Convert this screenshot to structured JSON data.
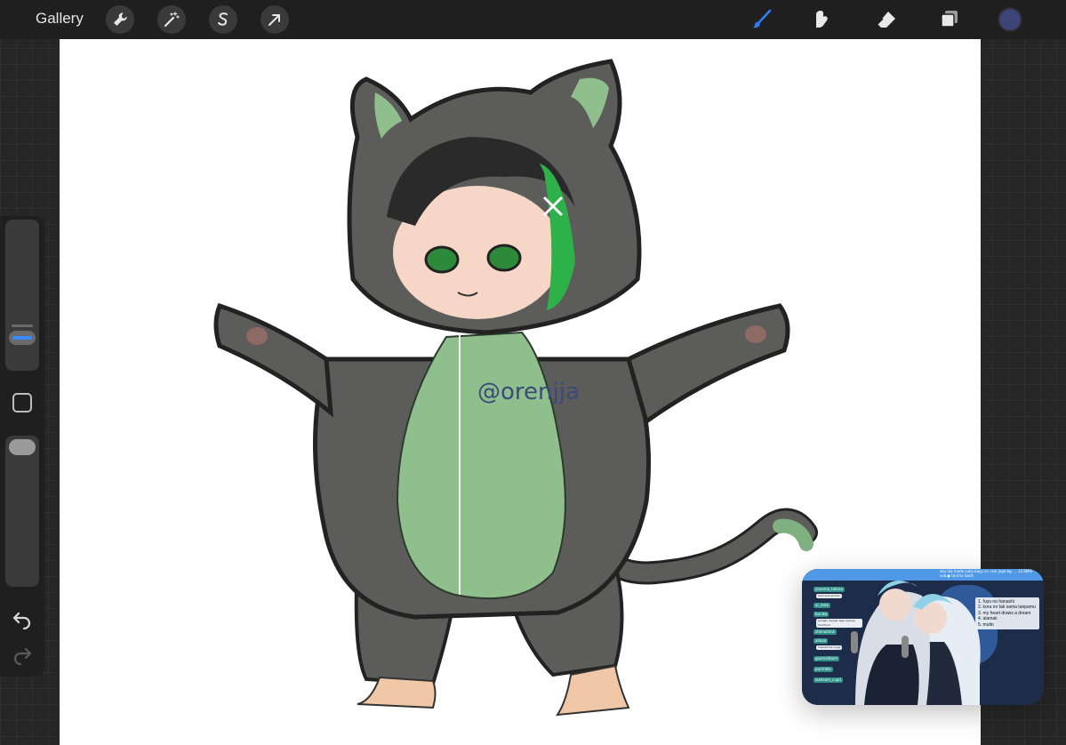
{
  "toolbar": {
    "gallery_label": "Gallery",
    "left_tools": [
      "wrench-icon",
      "magic-wand-icon",
      "selection-icon",
      "arrow-icon"
    ],
    "right_tools": [
      "brush-icon",
      "smudge-icon",
      "eraser-icon",
      "layers-icon"
    ],
    "active_tool": "brush-icon",
    "accent_color": "#2f7df6",
    "current_color": "#3d4477"
  },
  "canvas": {
    "watermark": "@orenjja"
  },
  "pip": {
    "header_note": "aku nla mode suka bayy co. lain juga bg. ... 1234Mil sub ● terima kasih",
    "chat_users": [
      "yinumia_takasu",
      "ai_neko",
      "bunika",
      "shenaminz",
      "ahana",
      "goomsitbom",
      "purrinkle",
      "wahaam_cupd"
    ],
    "chat_messages": [
      "halo semua halo",
      "pengen dengar lagu jepang duuhh ini",
      "shenaminz nyayi"
    ],
    "songs": [
      "1. fuyu no hanashi",
      "2. kora no tak sama tanpamu",
      "3. my heart draws a dream",
      "4. alamak",
      "5. multo"
    ]
  }
}
